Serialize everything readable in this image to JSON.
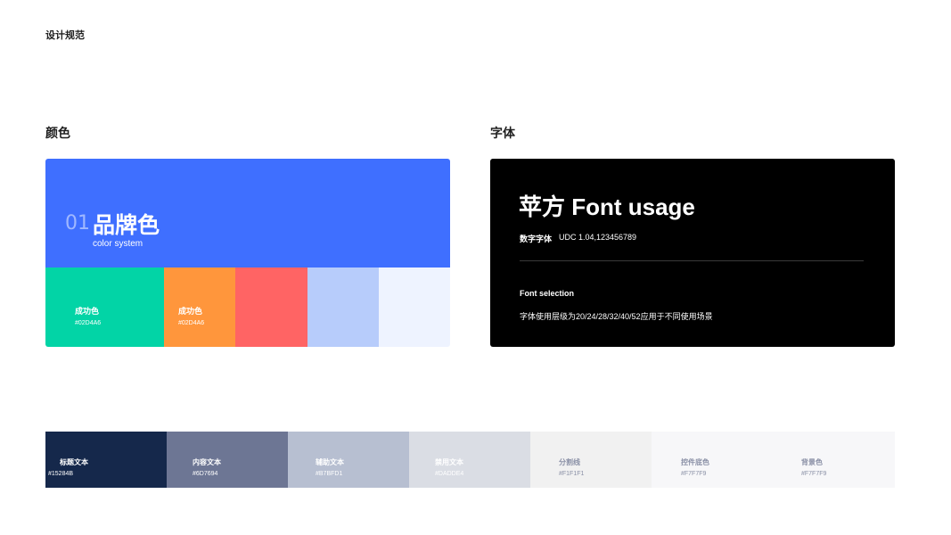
{
  "page_title": "设计规范",
  "color_section": {
    "title": "颜色",
    "brand": {
      "number": "01",
      "name": "品牌色",
      "subtitle": "color system",
      "color": "#3F6FFF"
    },
    "swatches": [
      {
        "label": "成功色",
        "hex": "#02D4A6",
        "color": "#02D4A6"
      },
      {
        "label": "成功色",
        "hex": "#02D4A6",
        "color": "#FF963C"
      },
      {
        "label": "",
        "hex": "",
        "color": "#FF6464"
      },
      {
        "label": "",
        "hex": "",
        "color": "#B7CCFB"
      },
      {
        "label": "",
        "hex": "",
        "color": "#EEF3FF"
      }
    ]
  },
  "font_section": {
    "title": "字体",
    "headline": "苹方 Font usage",
    "digits_label": "数字字体",
    "digits_value": "UDC  1.04,123456789",
    "selection_title": "Font selection",
    "selection_desc": "字体使用层级为20/24/28/32/40/52应用于不同使用场景"
  },
  "text_colors": [
    {
      "label": "标题文本",
      "hex": "#15284B",
      "color": "#15284B",
      "text_color": "#FFFFFF"
    },
    {
      "label": "内容文本",
      "hex": "#6D7694",
      "color": "#6D7694",
      "text_color": "#FFFFFF"
    },
    {
      "label": "辅助文本",
      "hex": "#B7BFD1",
      "color": "#B7BFD1",
      "text_color": "#FFFFFF"
    },
    {
      "label": "禁用文本",
      "hex": "#DADDE4",
      "color": "#DADDE4",
      "text_color": "#FFFFFF"
    },
    {
      "label": "分割线",
      "hex": "#F1F1F1",
      "color": "#F1F1F1",
      "text_color": "#8A90A6"
    },
    {
      "label": "控件底色",
      "hex": "#F7F7F9",
      "color": "#F7F7F9",
      "text_color": "#8A90A6"
    },
    {
      "label": "背景色",
      "hex": "#F7F7F9",
      "color": "#F7F7F9",
      "text_color": "#8A90A6"
    }
  ]
}
